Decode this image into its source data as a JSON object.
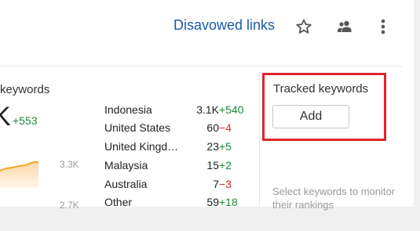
{
  "header": {
    "link_label": "Disavowed links",
    "icons": [
      "star-icon",
      "users-icon",
      "more-vertical-icon"
    ]
  },
  "keywords": {
    "title": "keywords",
    "value": "K",
    "delta": "+553",
    "axis_top": "3.3K",
    "axis_bottom": "2.7K",
    "countries": [
      {
        "name": "Indonesia",
        "count": "3.1K",
        "delta": "+540"
      },
      {
        "name": "United States",
        "count": "60",
        "delta": "−4"
      },
      {
        "name": "United Kingd…",
        "count": "23",
        "delta": "+5"
      },
      {
        "name": "Malaysia",
        "count": "15",
        "delta": "+2"
      },
      {
        "name": "Australia",
        "count": "7",
        "delta": "−3"
      },
      {
        "name": "Other",
        "count": "59",
        "delta": "+18"
      }
    ]
  },
  "tracked": {
    "title": "Tracked keywords",
    "add_label": "Add",
    "hint": "Select keywords to monitor their rankings"
  },
  "colors": {
    "link": "#1a5aa6",
    "positive": "#1f8a3c",
    "negative": "#d02b2b",
    "highlight": "#e2232f",
    "chart_line": "#f5a623"
  }
}
